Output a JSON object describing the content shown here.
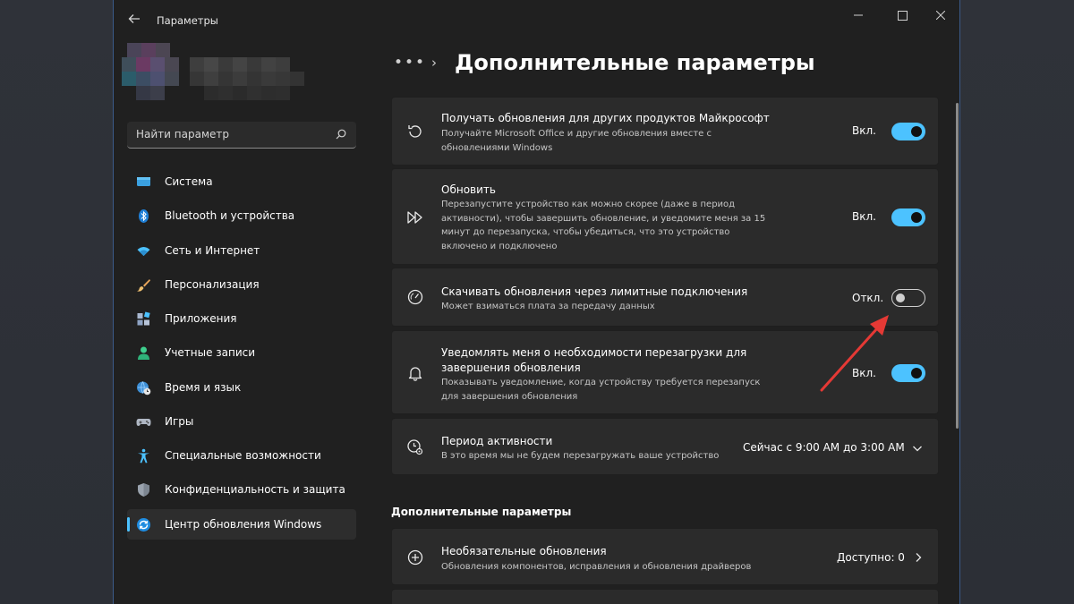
{
  "window": {
    "app_title": "Параметры",
    "back_icon": "back-arrow-icon",
    "minimize_icon": "minimize-icon",
    "maximize_icon": "maximize-icon",
    "close_icon": "close-icon"
  },
  "search": {
    "value": "Найти параметр",
    "icon": "search-icon"
  },
  "sidebar": {
    "items": [
      {
        "label": "Система",
        "icon": "monitor-icon",
        "active": false
      },
      {
        "label": "Bluetooth и устройства",
        "icon": "bluetooth-icon",
        "active": false
      },
      {
        "label": "Сеть и Интернет",
        "icon": "wifi-icon",
        "active": false
      },
      {
        "label": "Персонализация",
        "icon": "brush-icon",
        "active": false
      },
      {
        "label": "Приложения",
        "icon": "apps-icon",
        "active": false
      },
      {
        "label": "Учетные записи",
        "icon": "person-icon",
        "active": false
      },
      {
        "label": "Время и язык",
        "icon": "globe-clock-icon",
        "active": false
      },
      {
        "label": "Игры",
        "icon": "gamepad-icon",
        "active": false
      },
      {
        "label": "Специальные возможности",
        "icon": "accessibility-icon",
        "active": false
      },
      {
        "label": "Конфиденциальность и защита",
        "icon": "shield-icon",
        "active": false
      },
      {
        "label": "Центр обновления Windows",
        "icon": "windows-update-icon",
        "active": true
      }
    ]
  },
  "main": {
    "breadcrumb_more": "•••",
    "breadcrumb_chevron": "›",
    "title": "Дополнительные параметры",
    "settings": [
      {
        "icon": "refresh-icon",
        "title": "Получать обновления для других продуктов Майкрософт",
        "desc": [
          "Получайте Microsoft Office и другие обновления вместе с",
          "обновлениями Windows"
        ],
        "state": "Вкл.",
        "on": true
      },
      {
        "icon": "fast-forward-icon",
        "title": "Обновить",
        "desc": [
          "Перезапустите устройство как можно скорее (даже в период",
          "активности), чтобы завершить обновление, и уведомите меня за 15",
          "минут до перезапуска, чтобы убедиться, что это устройство",
          "включено и подключено"
        ],
        "state": "Вкл.",
        "on": true
      },
      {
        "icon": "speedometer-icon",
        "title": "Скачивать обновления через лимитные подключения",
        "desc": [
          "Может взиматься плата за передачу данных"
        ],
        "state": "Откл.",
        "on": false
      },
      {
        "icon": "bell-icon",
        "title": [
          "Уведомлять меня о необходимости перезагрузки для",
          "завершения обновления"
        ],
        "desc": [
          "Показывать уведомление, когда устройству требуется перезапуск",
          "для завершения обновления"
        ],
        "state": "Вкл.",
        "on": true
      }
    ],
    "active_hours": {
      "icon": "clock-gear-icon",
      "title": "Период активности",
      "desc": "В это время мы не будем перезагружать ваше устройство",
      "value": "Сейчас с 9:00 AM до 3:00 AM",
      "chevron_icon": "chevron-down-icon"
    },
    "section_title": "Дополнительные параметры",
    "optional_updates": {
      "icon": "plus-circle-icon",
      "title": "Необязательные обновления",
      "desc": "Обновления компонентов, исправления и обновления драйверов",
      "value": "Доступно: 0",
      "chevron_icon": "chevron-right-icon"
    }
  },
  "colors": {
    "accent": "#4cc2ff",
    "annotation_arrow": "#e53935",
    "window_bg": "#202020",
    "card_bg": "#2b2b2b"
  }
}
